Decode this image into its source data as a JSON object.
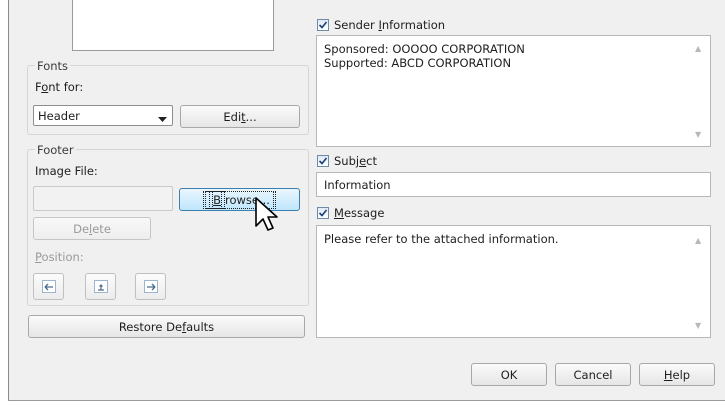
{
  "fonts": {
    "group_label": "Fonts",
    "font_for_label_pre": "F",
    "font_for_label_ul": "o",
    "font_for_label_post": "nt for:",
    "font_for_value": "Header",
    "edit_pre": "Edi",
    "edit_ul": "t",
    "edit_post": "..."
  },
  "footer": {
    "group_label": "Footer",
    "image_file_label": "Image File:",
    "image_file_value": "",
    "browse_pre": "",
    "browse_ul": "B",
    "browse_post": "rowse...",
    "delete_pre": "De",
    "delete_ul": "l",
    "delete_post": "ete",
    "position_pre": "",
    "position_ul": "P",
    "position_post": "osition:"
  },
  "restore_defaults": {
    "pre": "Restore De",
    "ul": "f",
    "post": "aults"
  },
  "sender_information": {
    "checked": true,
    "label_pre": "Sender ",
    "label_ul": "I",
    "label_post": "nformation",
    "lines": [
      "Sponsored: OOOOO CORPORATION",
      "Supported: ABCD CORPORATION"
    ]
  },
  "subject": {
    "checked": true,
    "label_pre": "Subj",
    "label_ul": "e",
    "label_post": "ct",
    "value": "Information"
  },
  "message": {
    "checked": true,
    "label_pre": "",
    "label_ul": "M",
    "label_post": "essage",
    "value": "Please refer to the attached information."
  },
  "buttons": {
    "ok": "OK",
    "cancel": "Cancel",
    "help_pre": "",
    "help_ul": "H",
    "help_post": "elp"
  },
  "icons": {
    "position_left": "arrow-left-icon",
    "position_center": "arrow-center-icon",
    "position_right": "arrow-right-icon",
    "cursor": "mouse-pointer-icon"
  }
}
